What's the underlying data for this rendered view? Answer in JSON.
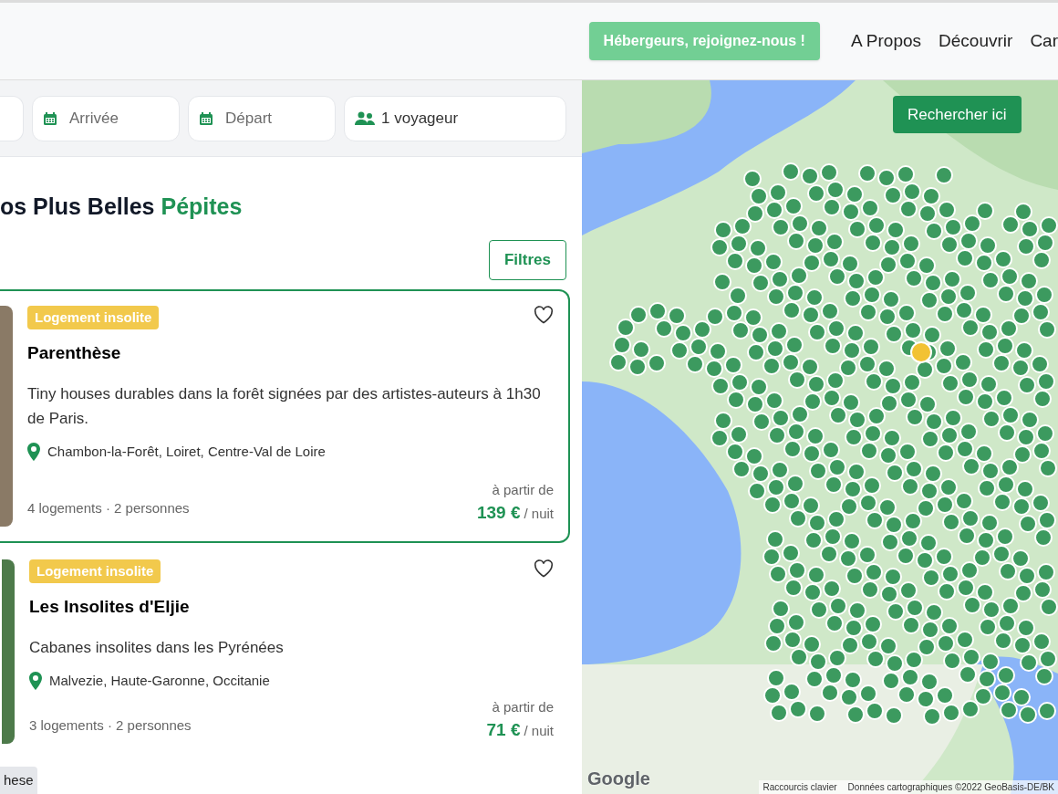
{
  "header": {
    "cta": "Hébergeurs, rejoignez-nous !",
    "nav": [
      "A Propos",
      "Découvrir",
      "Car"
    ]
  },
  "search": {
    "fields": [
      {
        "kind": "date",
        "placeholder": "Arrivée"
      },
      {
        "kind": "date",
        "placeholder": "Départ"
      },
      {
        "kind": "guests",
        "value": "1 voyageur"
      }
    ]
  },
  "heading": {
    "text": "os Plus Belles ",
    "highlight": "Pépites"
  },
  "filters_button": "Filtres",
  "listings": [
    {
      "selected": true,
      "favorite": false,
      "badge": "Logement insolite",
      "title": "Parenthèse",
      "description": "Tiny houses durables dans la forêt signées par des artistes-auteurs à 1h30 de Paris.",
      "location": "Chambon-la-Forêt, Loiret, Centre-Val de Loire",
      "capacity": "4 logements · 2 personnes",
      "price_prefix": "à partir de",
      "price": "139 €",
      "price_unit": "/ nuit"
    },
    {
      "selected": false,
      "favorite": false,
      "badge": "Logement insolite",
      "title": "Les Insolites d'Eljie",
      "description": "Cabanes insolites dans les Pyrénées",
      "location": "Malvezie, Haute-Garonne, Occitanie",
      "capacity": "3 logements · 2 personnes",
      "price_prefix": "à partir de",
      "price": "71 €",
      "price_unit": "/ nuit"
    }
  ],
  "tooltip": "hese",
  "map": {
    "search_here": "Rechercher ici",
    "logo": "Google",
    "shortcuts": "Raccourcis clavier",
    "attribution": "Données cartographiques ©2022 GeoBasis-DE/BK"
  }
}
